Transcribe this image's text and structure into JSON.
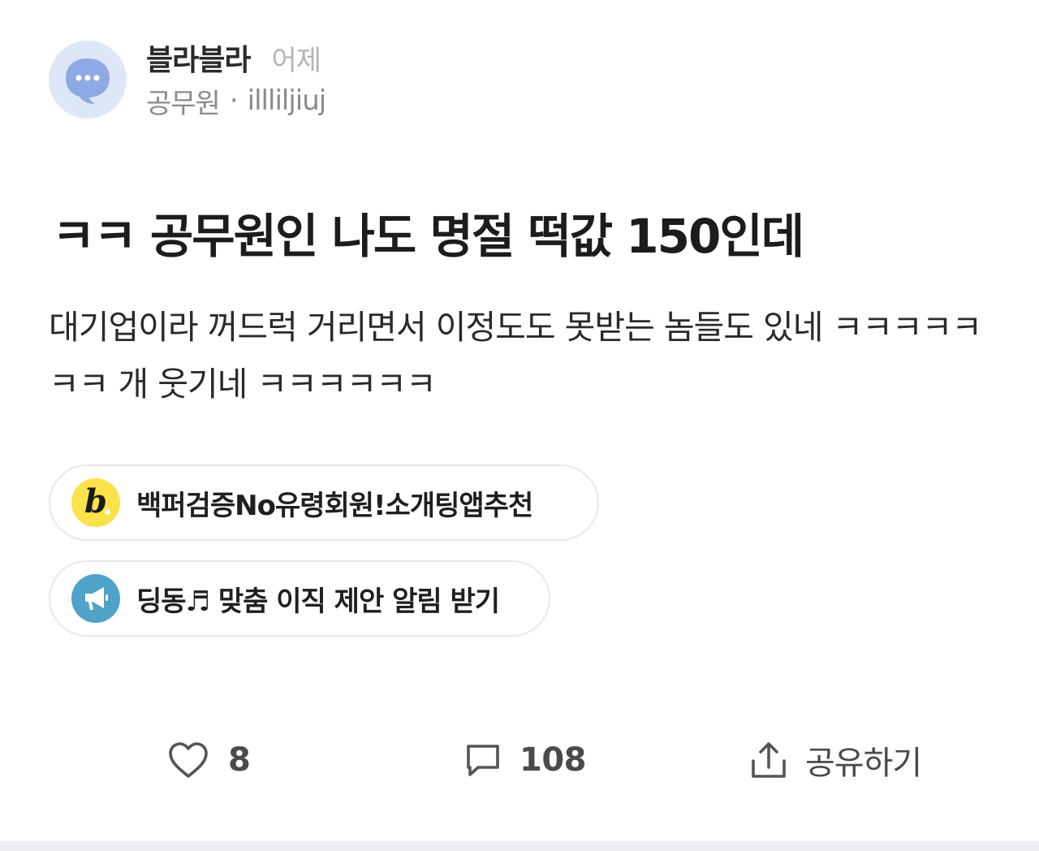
{
  "header": {
    "avatar_icon": "chat-bubble-icon",
    "author_name": "블라블라",
    "post_time": "어제",
    "company": "공무원",
    "separator": "·",
    "nickname": "illliljiuj"
  },
  "post": {
    "title": "ㅋㅋ 공무원인 나도 명절 떡값 150인데",
    "body": "대기업이라 꺼드럭 거리면서 이정도도 못받는 놈들도 있네 ㅋㅋㅋㅋㅋㅋㅋ 개 웃기네 ㅋㅋㅋㅋㅋㅋ"
  },
  "promos": [
    {
      "icon": "b-logo-icon",
      "label": "백퍼검증No유령회원!소개팅앱추천",
      "color": "#fbe14a"
    },
    {
      "icon": "megaphone-icon",
      "label": "딩동♬ 맞춤 이직 제안 알림 받기",
      "color": "#4fa3c8"
    }
  ],
  "actions": {
    "like_icon": "heart-icon",
    "like_count": "8",
    "comment_icon": "comment-icon",
    "comment_count": "108",
    "share_icon": "share-icon",
    "share_label": "공유하기"
  }
}
